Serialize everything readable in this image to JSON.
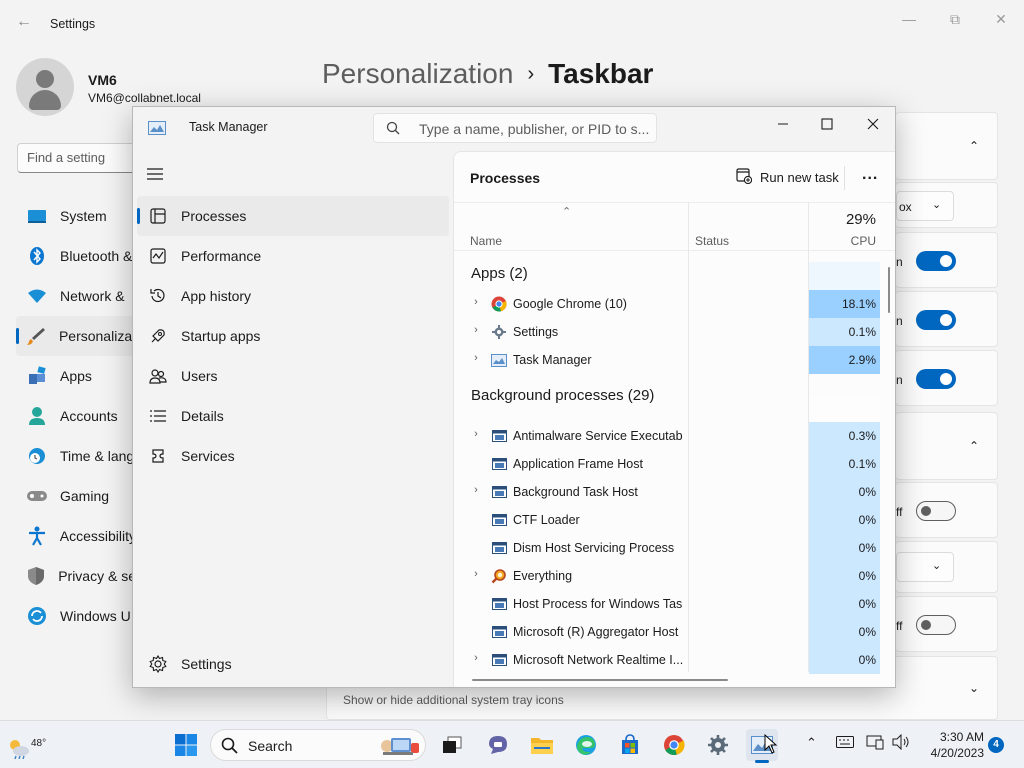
{
  "settings": {
    "window_title": "Settings",
    "user": {
      "name": "VM6",
      "email": "VM6@collabnet.local"
    },
    "search_placeholder": "Find a setting",
    "breadcrumb": {
      "parent": "Personalization",
      "separator": "›",
      "current": "Taskbar"
    },
    "nav": [
      {
        "label": "System",
        "icon": "system-icon"
      },
      {
        "label": "Bluetooth &",
        "icon": "bluetooth-icon"
      },
      {
        "label": "Network &",
        "icon": "network-icon"
      },
      {
        "label": "Personalizat",
        "icon": "personalization-icon",
        "active": true
      },
      {
        "label": "Apps",
        "icon": "apps-icon"
      },
      {
        "label": "Accounts",
        "icon": "accounts-icon"
      },
      {
        "label": "Time & lang",
        "icon": "time-language-icon"
      },
      {
        "label": "Gaming",
        "icon": "gaming-icon"
      },
      {
        "label": "Accessibility",
        "icon": "accessibility-icon"
      },
      {
        "label": "Privacy & se",
        "icon": "privacy-icon"
      },
      {
        "label": "Windows U",
        "icon": "windows-update-icon"
      }
    ],
    "right_cards": {
      "dropdown_fragment": "ox",
      "toggle_fragment_on": "n",
      "toggle_fragment_off": "ff"
    },
    "tray_hint": "Show or hide additional system tray icons"
  },
  "task_manager": {
    "title": "Task Manager",
    "search_placeholder": "Type a name, publisher, or PID to s...",
    "nav": [
      {
        "label": "Processes",
        "icon": "processes-icon",
        "active": true
      },
      {
        "label": "Performance",
        "icon": "performance-icon"
      },
      {
        "label": "App history",
        "icon": "app-history-icon"
      },
      {
        "label": "Startup apps",
        "icon": "startup-apps-icon"
      },
      {
        "label": "Users",
        "icon": "users-icon"
      },
      {
        "label": "Details",
        "icon": "details-icon"
      },
      {
        "label": "Services",
        "icon": "services-icon"
      }
    ],
    "settings_label": "Settings",
    "panel_title": "Processes",
    "run_new_task": "Run new task",
    "more": "...",
    "columns": {
      "name": "Name",
      "status": "Status",
      "cpu_total": "29%",
      "cpu": "CPU"
    },
    "groups": [
      {
        "label": "Apps (2)",
        "processes": [
          {
            "name": "Google Chrome (10)",
            "icon": "chrome-icon",
            "cpu": "18.1%",
            "expandable": true,
            "heat": "hot"
          },
          {
            "name": "Settings",
            "icon": "settings-gear-icon",
            "cpu": "0.1%",
            "expandable": true,
            "heat": "low"
          },
          {
            "name": "Task Manager",
            "icon": "task-manager-icon",
            "cpu": "2.9%",
            "expandable": true,
            "heat": "hot"
          }
        ]
      },
      {
        "label": "Background processes (29)",
        "processes": [
          {
            "name": "Antimalware Service Executable",
            "icon": "process-window-icon",
            "cpu": "0.3%",
            "expandable": true,
            "heat": "low"
          },
          {
            "name": "Application Frame Host",
            "icon": "process-window-icon",
            "cpu": "0.1%",
            "expandable": false,
            "heat": "low"
          },
          {
            "name": "Background Task Host",
            "icon": "process-window-icon",
            "cpu": "0%",
            "expandable": true,
            "heat": "low"
          },
          {
            "name": "CTF Loader",
            "icon": "process-window-icon",
            "cpu": "0%",
            "expandable": false,
            "heat": "low"
          },
          {
            "name": "Dism Host Servicing Process",
            "icon": "process-window-icon",
            "cpu": "0%",
            "expandable": false,
            "heat": "low"
          },
          {
            "name": "Everything",
            "icon": "everything-search-icon",
            "cpu": "0%",
            "expandable": true,
            "heat": "low"
          },
          {
            "name": "Host Process for Windows Tasks",
            "icon": "process-window-icon",
            "cpu": "0%",
            "expandable": false,
            "heat": "low"
          },
          {
            "name": "Microsoft (R) Aggregator Host",
            "icon": "process-window-icon",
            "cpu": "0%",
            "expandable": false,
            "heat": "low"
          },
          {
            "name": "Microsoft Network Realtime I...",
            "icon": "process-window-icon",
            "cpu": "0%",
            "expandable": true,
            "heat": "low"
          }
        ]
      }
    ]
  },
  "taskbar": {
    "weather_temp": "48°",
    "search_label": "Search",
    "time": "3:30 AM",
    "date": "4/20/2023",
    "notification_count": "4",
    "accent": "#0067c0"
  }
}
